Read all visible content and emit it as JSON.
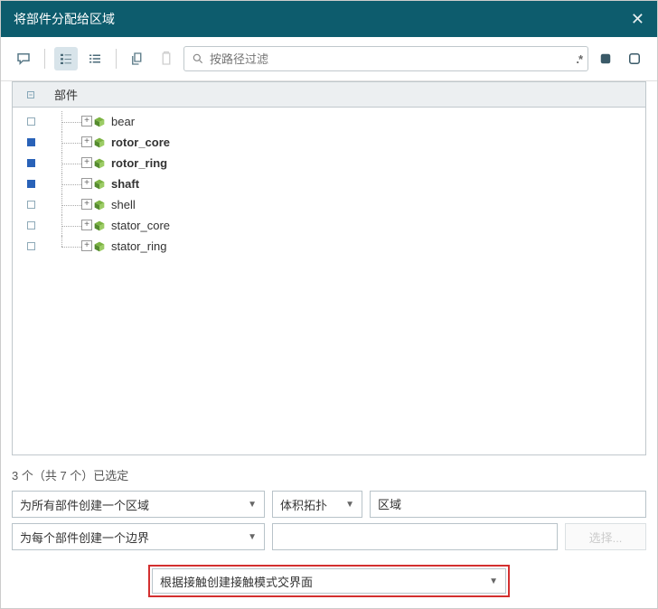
{
  "title": "将部件分配给区域",
  "search": {
    "placeholder": "按路径过滤"
  },
  "tree_header": {
    "label": "部件"
  },
  "parts": [
    {
      "name": "bear",
      "selected": false
    },
    {
      "name": "rotor_core",
      "selected": true
    },
    {
      "name": "rotor_ring",
      "selected": true
    },
    {
      "name": "shaft",
      "selected": true
    },
    {
      "name": "shell",
      "selected": false
    },
    {
      "name": "stator_core",
      "selected": false
    },
    {
      "name": "stator_ring",
      "selected": false
    }
  ],
  "status": "3 个（共 7 个）已选定",
  "form": {
    "region_mode": "为所有部件创建一个区域",
    "topology": "体积拓扑",
    "region_name": "区域",
    "boundary_mode": "为每个部件创建一个边界",
    "boundary_name": "",
    "choose_btn": "选择...",
    "interface_mode": "根据接触创建接触模式交界面"
  },
  "icons": {
    "comment": "comment-icon",
    "list_tree": "list-tree-icon",
    "list": "list-icon",
    "copy": "copy-icon",
    "paste": "paste-icon",
    "square_fill": "square-filled-icon",
    "square": "square-outline-icon"
  }
}
